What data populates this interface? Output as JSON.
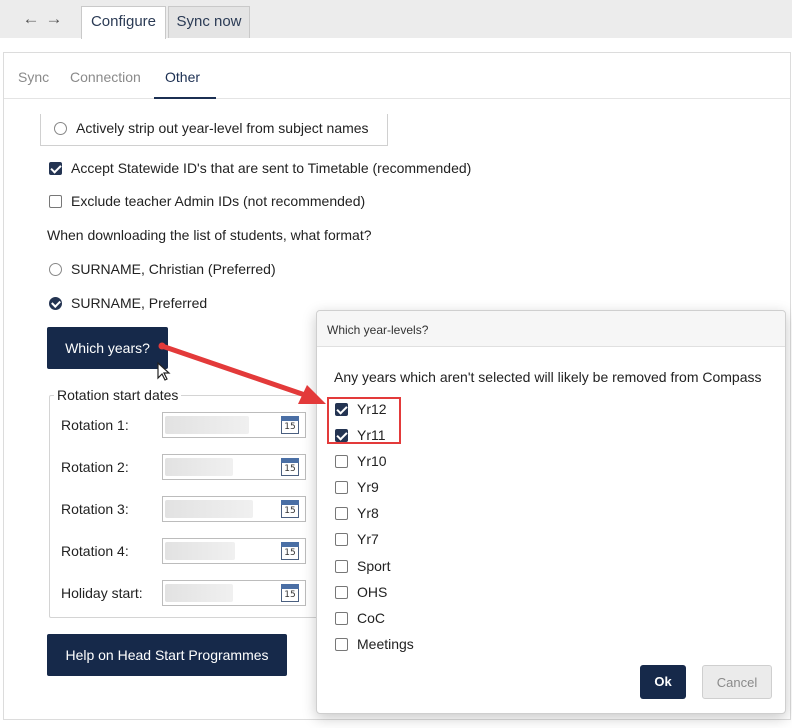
{
  "window": {
    "tabs": [
      {
        "label": "Configure",
        "active": true
      },
      {
        "label": "Sync now",
        "active": false
      }
    ]
  },
  "subtabs": [
    {
      "label": "Sync",
      "active": false
    },
    {
      "label": "Connection",
      "active": false
    },
    {
      "label": "Other",
      "active": true
    }
  ],
  "options": {
    "strip_year_level": {
      "label": "Actively strip out year-level from subject names",
      "checked": false
    },
    "accept_statewide": {
      "label": "Accept Statewide ID's that are sent to Timetable (recommended)",
      "checked": true
    },
    "exclude_teacher": {
      "label": "Exclude teacher Admin IDs (not recommended)",
      "checked": false
    },
    "format_question": "When downloading the list of students, what format?",
    "format_options": [
      {
        "label": "SURNAME, Christian (Preferred)",
        "checked": false
      },
      {
        "label": "SURNAME, Preferred",
        "checked": true
      }
    ]
  },
  "which_years_button": "Which years?",
  "rotation": {
    "legend": "Rotation start dates",
    "rows": [
      {
        "label": "Rotation 1:",
        "calendar": "15"
      },
      {
        "label": "Rotation 2:",
        "calendar": "15"
      },
      {
        "label": "Rotation 3:",
        "calendar": "15"
      },
      {
        "label": "Rotation 4:",
        "calendar": "15"
      },
      {
        "label": "Holiday start:",
        "calendar": "15"
      }
    ]
  },
  "help_button": "Help on Head Start Programmes",
  "dialog": {
    "title": "Which year-levels?",
    "description": "Any years which aren't selected will likely be removed from Compass",
    "items": [
      {
        "label": "Yr12",
        "checked": true
      },
      {
        "label": "Yr11",
        "checked": true
      },
      {
        "label": "Yr10",
        "checked": false
      },
      {
        "label": "Yr9",
        "checked": false
      },
      {
        "label": "Yr8",
        "checked": false
      },
      {
        "label": "Yr7",
        "checked": false
      },
      {
        "label": "Sport",
        "checked": false
      },
      {
        "label": "OHS",
        "checked": false
      },
      {
        "label": "CoC",
        "checked": false
      },
      {
        "label": "Meetings",
        "checked": false
      }
    ],
    "ok_label": "Ok",
    "cancel_label": "Cancel"
  },
  "icons": {
    "back": "arrow-left-icon",
    "forward": "arrow-right-icon",
    "calendar": "calendar-icon",
    "cursor": "mouse-pointer-icon"
  },
  "colors": {
    "accent": "#16294a",
    "annotation": "#e33a3a"
  }
}
